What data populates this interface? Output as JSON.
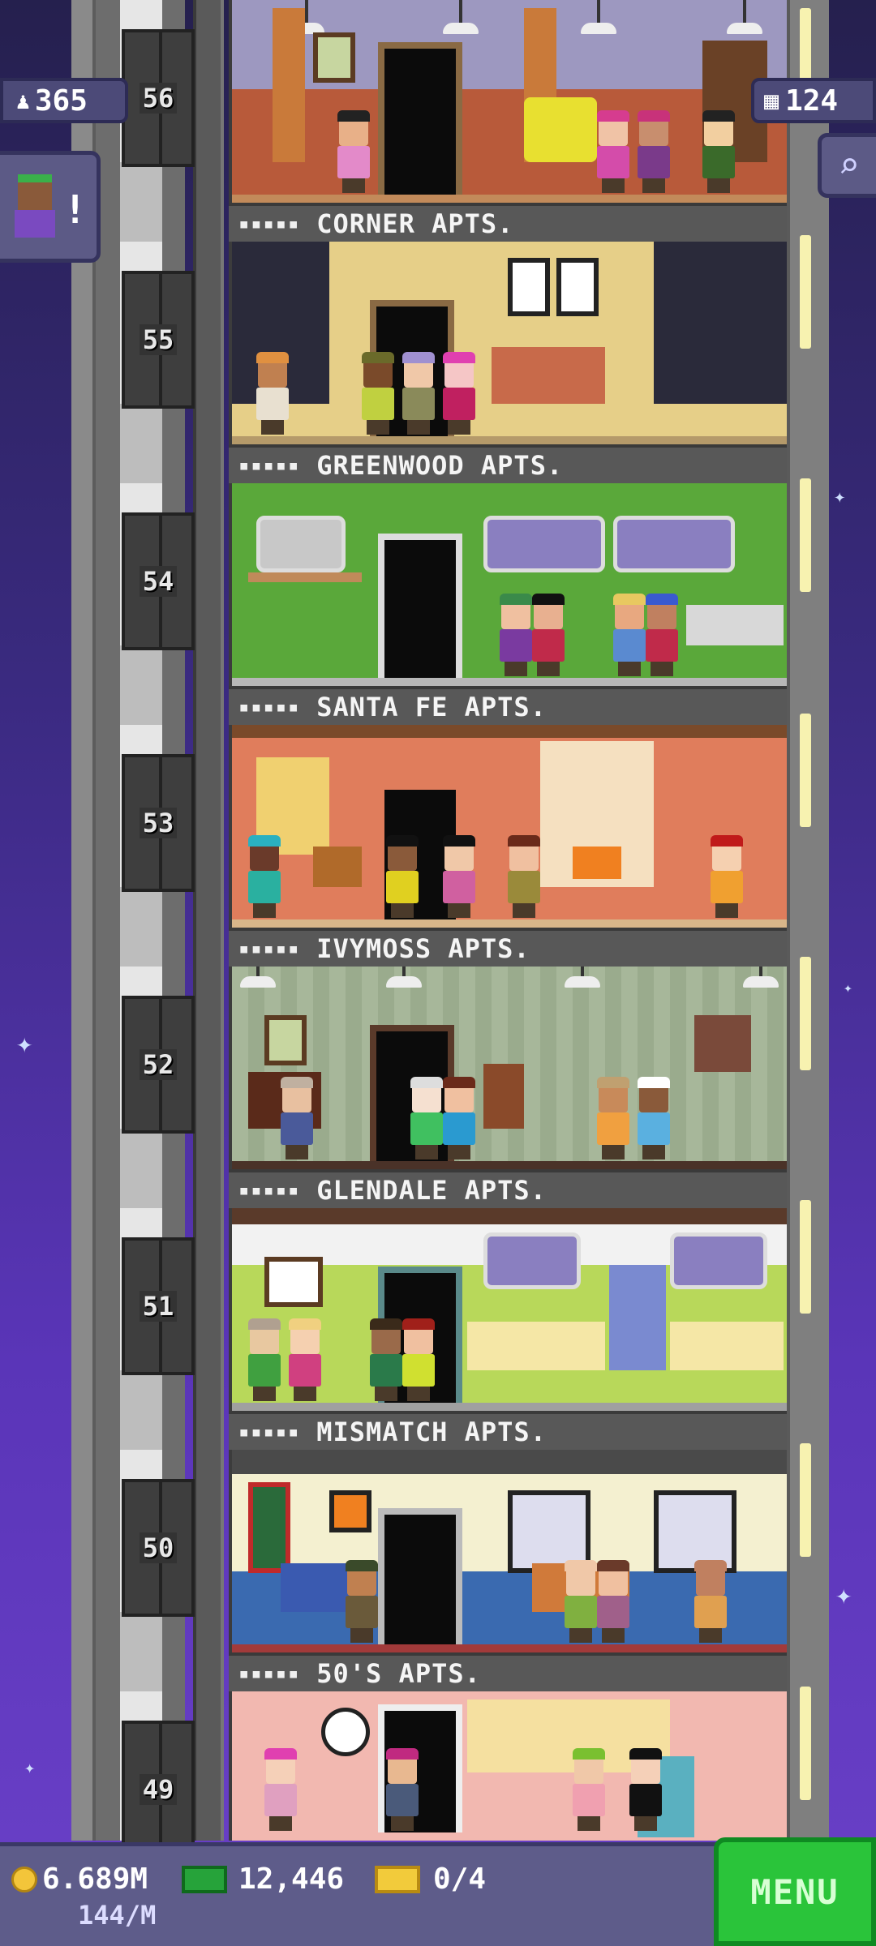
{
  "hud": {
    "population": "365",
    "floors_count": "124",
    "coins": "6.689M",
    "coins_rate": "144/M",
    "bux": "12,446",
    "tickets": "0/4",
    "menu_label": "MENU"
  },
  "floors": [
    {
      "number": "56",
      "name": "CORNER APTS.",
      "stars": "▪▪▪▪▪",
      "wall": "#a49fc4",
      "floor_color": "#c28a5a"
    },
    {
      "number": "55",
      "name": "GREENWOOD APTS.",
      "stars": "▪▪▪▪▪",
      "wall": "#e6cf88",
      "floor_color": "#b59a6a"
    },
    {
      "number": "54",
      "name": "SANTA FE APTS.",
      "stars": "▪▪▪▪▪",
      "wall": "#5aa83a",
      "floor_color": "#b8b8b8"
    },
    {
      "number": "53",
      "name": "IVYMOSS APTS.",
      "stars": "▪▪▪▪▪",
      "wall": "#e07d5c",
      "floor_color": "#d8b68a"
    },
    {
      "number": "52",
      "name": "GLENDALE APTS.",
      "stars": "▪▪▪▪▪",
      "wall": "#a7b79a",
      "floor_color": "#4a3228"
    },
    {
      "number": "51",
      "name": "MISMATCH APTS.",
      "stars": "▪▪▪▪▪",
      "wall": "#f2f2f2",
      "floor_color": "#a0a0a0"
    },
    {
      "number": "50",
      "name": "50'S APTS.",
      "stars": "▪▪▪▪▪",
      "wall": "#f4f0d0",
      "floor_color": "#a23a3a"
    },
    {
      "number": "49",
      "name": "",
      "stars": "",
      "wall": "#f2b8b0",
      "floor_color": "#c49070"
    }
  ]
}
